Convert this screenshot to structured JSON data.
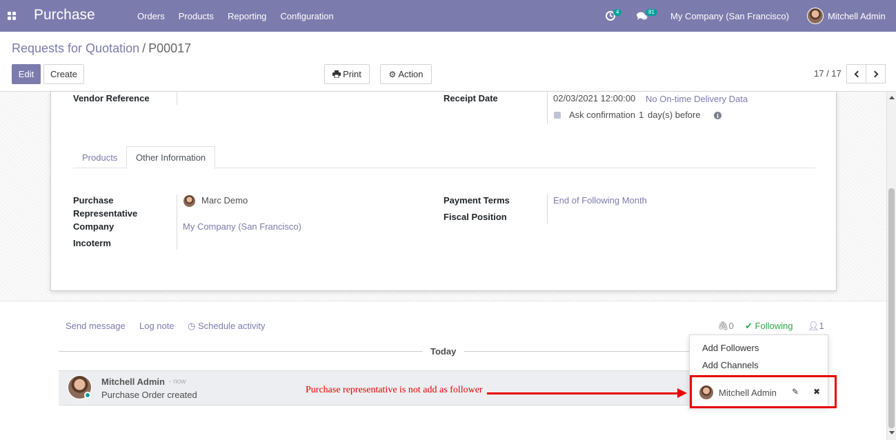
{
  "navbar": {
    "brand": "Purchase",
    "menu": [
      "Orders",
      "Products",
      "Reporting",
      "Configuration"
    ],
    "activity_count": "4",
    "message_count": "81",
    "company": "My Company (San Francisco)",
    "user": "Mitchell Admin"
  },
  "breadcrumb": {
    "parent": "Requests for Quotation",
    "separator": "/",
    "current": "P00017"
  },
  "toolbar": {
    "edit_label": "Edit",
    "create_label": "Create",
    "print_label": "Print",
    "action_label": "Action",
    "pager": "17 / 17"
  },
  "form": {
    "vendor_reference_label": "Vendor Reference",
    "receipt_date_label": "Receipt Date",
    "receipt_date_value": "02/03/2021 12:00:00",
    "on_time_delivery": "No On-time Delivery Data",
    "ask_confirmation_label": "Ask confirmation",
    "ask_confirmation_days": "1",
    "ask_confirmation_suffix": "day(s) before",
    "tabs": [
      "Products",
      "Other Information"
    ],
    "purchase_rep_label_1": "Purchase",
    "purchase_rep_label_2": "Representative",
    "purchase_rep_value": "Marc Demo",
    "company_label": "Company",
    "company_value": "My Company (San Francisco)",
    "incoterm_label": "Incoterm",
    "payment_terms_label": "Payment Terms",
    "payment_terms_value": "End of Following Month",
    "fiscal_position_label": "Fiscal Position"
  },
  "chatter": {
    "send_message": "Send message",
    "log_note": "Log note",
    "schedule_activity": "Schedule activity",
    "attachments_count": "0",
    "following_label": "Following",
    "followers_count": "1",
    "today_label": "Today",
    "message": {
      "author": "Mitchell Admin",
      "time": "- now",
      "body": "Purchase Order created"
    }
  },
  "followers_dropdown": {
    "add_followers": "Add Followers",
    "add_channels": "Add Channels",
    "follower_name": "Mitchell Admin"
  },
  "annotation": {
    "text": "Purchase representative is not add as follower",
    "color": "#e60000"
  },
  "colors": {
    "brand": "#7c7bad",
    "online": "#00a09d",
    "following": "#28a745"
  }
}
